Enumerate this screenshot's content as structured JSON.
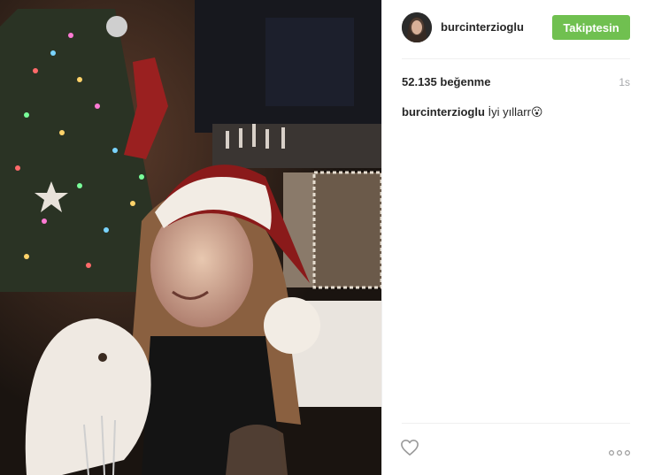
{
  "post": {
    "username": "burcinterzioglu",
    "follow_label": "Takiptesin",
    "likes": "52.135 beğenme",
    "time": "1s",
    "caption_user": "burcinterzioglu",
    "caption_text": "İyi yıllarr😮"
  },
  "colors": {
    "follow_button": "#70c050",
    "divider": "#efefef",
    "timestamp": "#a5a7aa"
  },
  "icons": [
    "heart-icon",
    "more-options-icon"
  ]
}
